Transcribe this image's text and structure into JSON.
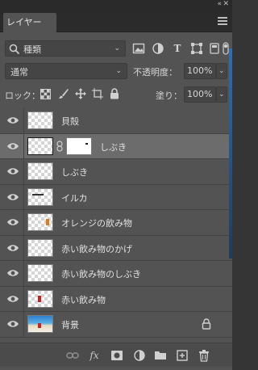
{
  "window": {
    "collapse_icon": "double-chevron-icon",
    "close_icon": "close-icon"
  },
  "tab": {
    "title": "レイヤー",
    "menu_icon": "panel-menu-icon"
  },
  "filter": {
    "search_icon": "search-icon",
    "kind_label": "種類",
    "filter_icons": [
      "image-filter-icon",
      "adjustment-filter-icon",
      "type-filter-icon",
      "shape-filter-icon",
      "smart-object-filter-icon",
      "filter-toggle-icon"
    ]
  },
  "blend": {
    "mode": "通常",
    "opacity_label": "不透明度：",
    "opacity_value": "100%"
  },
  "lockrow": {
    "label": "ロック：",
    "icons": [
      "lock-transparent-icon",
      "lock-paint-icon",
      "lock-move-icon",
      "lock-artboard-icon",
      "lock-all-icon"
    ],
    "fill_label": "塗り：",
    "fill_value": "100%"
  },
  "layers": [
    {
      "name": "貝殻",
      "thumb": "transparent",
      "selected": false,
      "mask": false,
      "locked": false
    },
    {
      "name": "しぶき",
      "thumb": "transparent",
      "selected": true,
      "mask": true,
      "locked": false
    },
    {
      "name": "しぶき",
      "thumb": "transparent",
      "selected": false,
      "mask": false,
      "locked": false
    },
    {
      "name": "イルカ",
      "thumb": "dolphin",
      "selected": false,
      "mask": false,
      "locked": false
    },
    {
      "name": "オレンジの飲み物",
      "thumb": "orange-drink",
      "selected": false,
      "mask": false,
      "locked": false
    },
    {
      "name": "赤い飲み物のかげ",
      "thumb": "transparent",
      "selected": false,
      "mask": false,
      "locked": false
    },
    {
      "name": "赤い飲み物のしぶき",
      "thumb": "transparent",
      "selected": false,
      "mask": false,
      "locked": false
    },
    {
      "name": "赤い飲み物",
      "thumb": "red-drink",
      "selected": false,
      "mask": false,
      "locked": false
    },
    {
      "name": "背景",
      "thumb": "beach-photo",
      "selected": false,
      "mask": false,
      "locked": true
    }
  ],
  "footer": {
    "icons": [
      "link-layers-icon",
      "fx-icon",
      "add-mask-icon",
      "adjustment-layer-icon",
      "new-group-icon",
      "new-layer-icon",
      "delete-layer-icon"
    ],
    "fx_text": "fx"
  },
  "colors": {
    "panel": "#535353",
    "selected_row": "#6c6c6c",
    "tabbar": "#2b2b2b"
  }
}
